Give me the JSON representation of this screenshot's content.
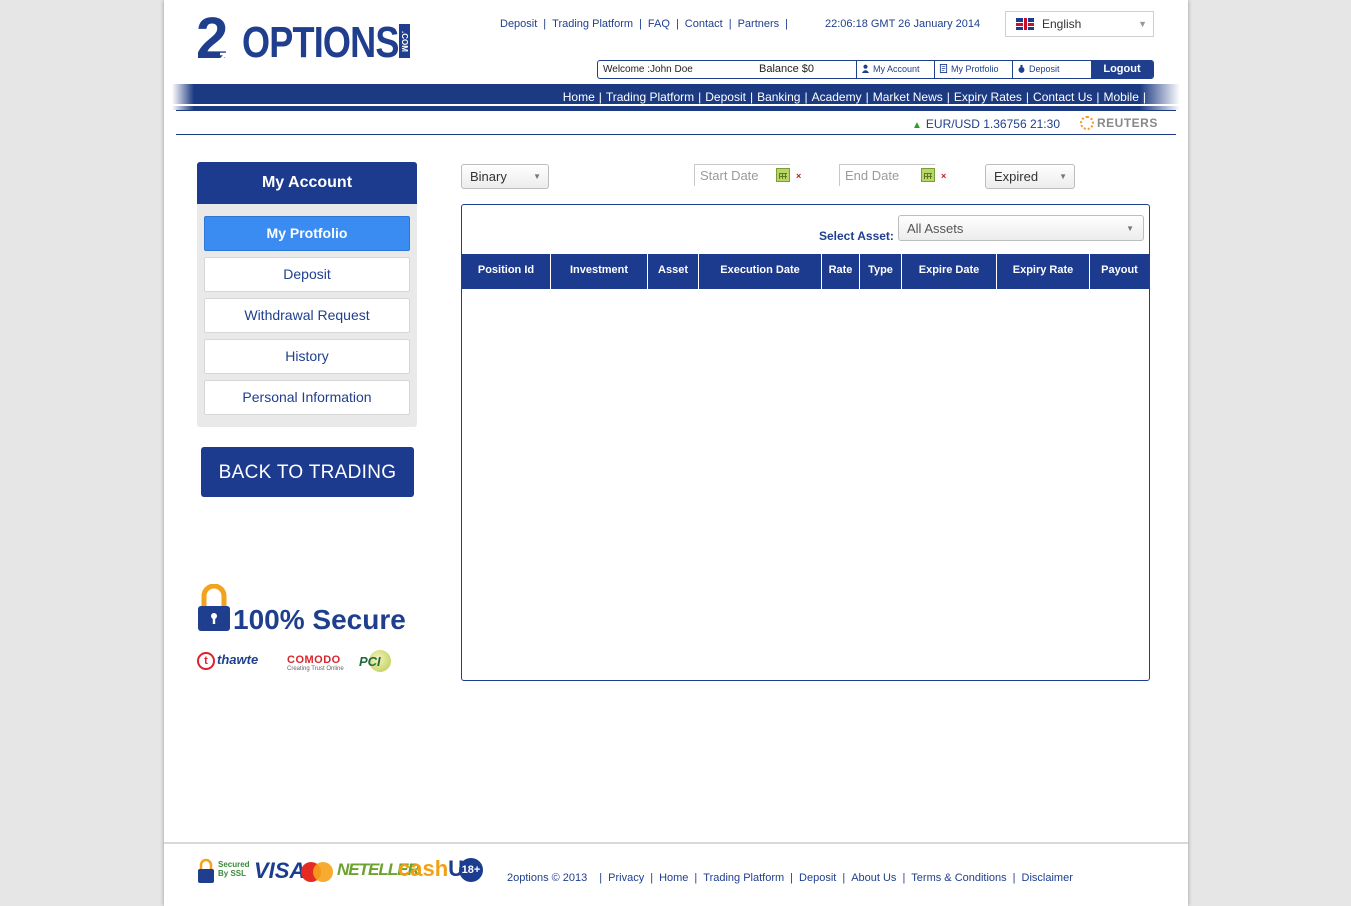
{
  "brand": {
    "logo_two": "2",
    "logo_text": "OPTIONS",
    "logo_com": ".COM"
  },
  "top_links": [
    "Deposit",
    "Trading Platform",
    "FAQ",
    "Contact",
    "Partners"
  ],
  "clock": "22:06:18 GMT 26 January 2014",
  "language": {
    "selected": "English",
    "flag_icon": "uk-flag-icon"
  },
  "account_bar": {
    "welcome": "Welcome :John Doe",
    "balance": "Balance $0",
    "my_account": "My Account",
    "my_portfolio": "My Protfolio",
    "deposit": "Deposit",
    "logout": "Logout"
  },
  "main_nav": [
    "Home",
    "Trading Platform",
    "Deposit",
    "Banking",
    "Academy",
    "Market News",
    "Expiry Rates",
    "Contact Us",
    "Mobile"
  ],
  "ticker": {
    "text": "EUR/USD 1.36756 21:30",
    "direction": "up",
    "source": "REUTERS"
  },
  "sidebar": {
    "title": "My Account",
    "items": [
      {
        "label": "My Protfolio",
        "active": true
      },
      {
        "label": "Deposit",
        "active": false
      },
      {
        "label": "Withdrawal Request",
        "active": false
      },
      {
        "label": "History",
        "active": false
      },
      {
        "label": "Personal Information",
        "active": false
      }
    ],
    "back_button": "BACK TO TRADING"
  },
  "secure": {
    "text": "100% Secure",
    "badges": {
      "thawte": "thawte",
      "comodo": "COMODO",
      "comodo_sub": "Creating Trust Online",
      "pci": "PCI"
    }
  },
  "filters": {
    "type_select": "Binary",
    "start_date_placeholder": "Start Date",
    "end_date_placeholder": "End Date",
    "clear_symbol": "×",
    "status_select": "Expired"
  },
  "table": {
    "asset_label": "Select Asset:",
    "asset_select": "All Assets",
    "columns": [
      "Position Id",
      "Investment",
      "Asset",
      "Execution Date",
      "Rate",
      "Type",
      "Expire Date",
      "Expiry Rate",
      "Payout"
    ],
    "rows": []
  },
  "footer": {
    "ssl": "Secured By SSL",
    "payment_logos": {
      "visa": "VISA",
      "mastercard": "MasterCard",
      "neteller": "NETELLER",
      "cashu_a": "cash",
      "cashu_b": "U",
      "age": "18+"
    },
    "copyright": "2options © 2013",
    "links": [
      "Privacy",
      "Home",
      "Trading Platform",
      "Deposit",
      "About Us",
      "Terms & Conditions",
      "Disclaimer"
    ]
  },
  "colors": {
    "brand_blue": "#1c3a8e",
    "active_blue": "#3a8cf3",
    "ticker_up": "#2aa02a"
  }
}
